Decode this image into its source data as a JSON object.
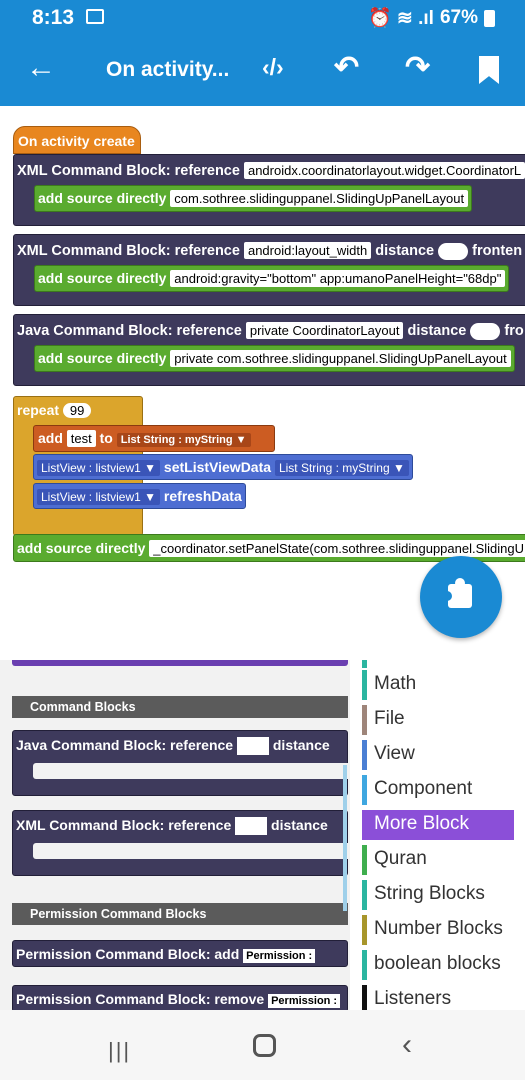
{
  "status_bar": {
    "time": "8:13",
    "battery": "67%",
    "signal_icons": "⏰ ≋ .ıl"
  },
  "app_bar": {
    "title": "On activity...",
    "code_icon": "‹/›",
    "back_icon": "←",
    "undo_icon": "↶",
    "redo_icon": "↷"
  },
  "workspace": {
    "event": {
      "label": "On activity create"
    },
    "blocks": [
      {
        "label": "XML Command Block: reference",
        "ref": "androidx.coordinatorlayout.widget.CoordinatorL",
        "inner_label": "add source directly",
        "inner_value": "com.sothree.slidinguppanel.SlidingUpPanelLayout"
      },
      {
        "label": "XML Command Block: reference",
        "ref": "android:layout_width",
        "distance_label": "distance",
        "extra": "fronten",
        "inner_label": "add source directly",
        "inner_value": "android:gravity=\"bottom\"  app:umanoPanelHeight=\"68dp\""
      },
      {
        "label": "Java Command Block: reference",
        "ref": "private CoordinatorLayout",
        "distance_label": "distance",
        "extra": "fro",
        "inner_label": "add source directly",
        "inner_value": "private com.sothree.slidinguppanel.SlidingUpPanelLayout"
      }
    ],
    "repeat": {
      "label": "repeat",
      "count": "99"
    },
    "add_block": {
      "label": "add",
      "value": "test",
      "to": "to",
      "list": "List String : myString ▼"
    },
    "listview_blocks": [
      {
        "var": "ListView : listview1 ▼",
        "method": "setListViewData",
        "arg": "List String : myString ▼"
      },
      {
        "var": "ListView : listview1 ▼",
        "method": "refreshData"
      }
    ],
    "bottom_block": {
      "label": "add source directly",
      "value": "_coordinator.setPanelState(com.sothree.slidinguppanel.SlidingU"
    }
  },
  "flyout": {
    "sections": [
      "Command Blocks",
      "Permission Command Blocks"
    ],
    "command_blocks": [
      {
        "label": "Java Command Block: reference",
        "distance": "distance"
      },
      {
        "label": "XML Command Block: reference",
        "distance": "distance"
      }
    ],
    "permission_blocks": [
      {
        "label": "Permission Command Block: add",
        "field": "Permission :"
      },
      {
        "label": "Permission Command Block: remove",
        "field": "Permission :"
      }
    ]
  },
  "categories": [
    {
      "label": "Math",
      "color": "#2bb5a0"
    },
    {
      "label": "File",
      "color": "#9e857a"
    },
    {
      "label": "View",
      "color": "#4a7fd4"
    },
    {
      "label": "Component",
      "color": "#3fa7e0"
    },
    {
      "label": "More Block",
      "color": "#8b4fd8"
    },
    {
      "label": "Quran",
      "color": "#3fae4e"
    },
    {
      "label": "String Blocks",
      "color": "#2bb5a0"
    },
    {
      "label": "Number Blocks",
      "color": "#a8962b"
    },
    {
      "label": "boolean blocks",
      "color": "#2bb5a0"
    },
    {
      "label": "Listeners",
      "color": "#111111"
    }
  ],
  "nav": {
    "recent": "|||",
    "back": "‹"
  }
}
